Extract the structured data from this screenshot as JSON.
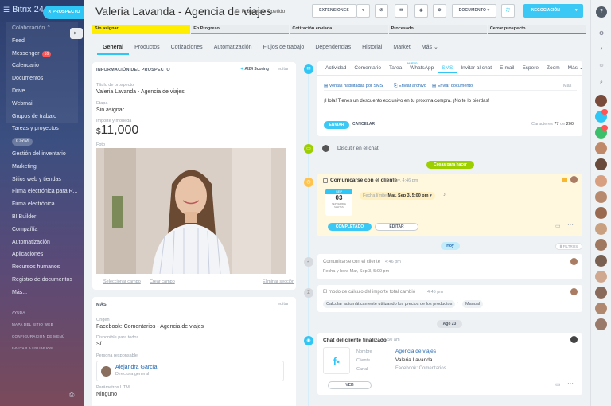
{
  "brand": "Bitrix 24",
  "sidebar": {
    "items": [
      {
        "label": "Colaboración",
        "kind": "group-head"
      },
      {
        "label": "Feed"
      },
      {
        "label": "Messenger",
        "badge": "16"
      },
      {
        "label": "Calendario"
      },
      {
        "label": "Documentos"
      },
      {
        "label": "Drive"
      },
      {
        "label": "Webmail"
      },
      {
        "label": "Grupos de trabajo"
      },
      {
        "label": "Tareas y proyectos"
      },
      {
        "label": "CRM",
        "kind": "crm"
      },
      {
        "label": "Gestión del inventario"
      },
      {
        "label": "Marketing"
      },
      {
        "label": "Sitios web y tiendas"
      },
      {
        "label": "Firma electrónica para R..."
      },
      {
        "label": "Firma electrónica"
      },
      {
        "label": "BI Builder"
      },
      {
        "label": "Compañía"
      },
      {
        "label": "Automatización"
      },
      {
        "label": "Aplicaciones"
      },
      {
        "label": "Recursos humanos"
      },
      {
        "label": "Registro de documentos"
      },
      {
        "label": "Más..."
      }
    ],
    "bottom": [
      "AYUDA",
      "MAPA DEL SITIO WEB",
      "CONFIGURACIÓN DE MENÚ",
      "INVITAR A USUARIOS"
    ]
  },
  "header": {
    "entity_tab": "PROSPECTO",
    "title": "Valeria Lavanda - Agencia de viajes",
    "repeat_label": "Prospecto repetido",
    "btn_extensions": "EXTENSIONES",
    "btn_document": "DOCUMENTO",
    "btn_negotiation": "NEGOCIACIÓN"
  },
  "stages": [
    {
      "label": "Sin asignar",
      "color": "#ffee00"
    },
    {
      "label": "En Progreso",
      "color": "#2fc6f6"
    },
    {
      "label": "Cotización enviada",
      "color": "#ffa900"
    },
    {
      "label": "Procesado",
      "color": "#7bd500"
    },
    {
      "label": "Cerrar prospecto",
      "color": "#00c4a0"
    }
  ],
  "tabs": [
    "General",
    "Productos",
    "Cotizaciones",
    "Automatización",
    "Flujos de trabajo",
    "Dependencias",
    "Historial",
    "Market",
    "Más"
  ],
  "info": {
    "heading": "INFORMACIÓN DEL PROSPECTO",
    "scoring": "AI24 Scoring",
    "edit": "editar",
    "title_label": "Título de prospecto",
    "title_value": "Valeria Lavanda - Agencia de viajes",
    "stage_label": "Etapa",
    "stage_value": "Sin asignar",
    "amount_label": "Importe y moneda",
    "amount_currency": "$",
    "amount_value": "11,000",
    "photo_label": "Foto",
    "select_field": "Seleccionar campo",
    "create_field": "Crear campo",
    "delete_section": "Eliminar sección"
  },
  "more": {
    "heading": "MÁS",
    "edit": "editar",
    "source_label": "Origen",
    "source_value": "Facebook: Comentarios - Agencia de viajes",
    "avail_label": "Disponible para todos",
    "avail_value": "Sí",
    "resp_label": "Persona responsable",
    "resp_name": "Alejandra García",
    "resp_role": "Directora general",
    "utm_label": "Parámetros UTM",
    "utm_value": "Ninguno"
  },
  "activity_tabs": [
    "Actividad",
    "Comentario",
    "Tarea",
    "WhatsApp",
    "SMS",
    "Invitar al chat",
    "E-mail",
    "Espere",
    "Zoom",
    "Más"
  ],
  "whatsapp_new": "NUEVO",
  "sms": {
    "enabled_link": "Ventas habilitadas por SMS",
    "send_file": "Enviar archivo",
    "send_doc": "Enviar documento",
    "more": "Más",
    "message": "¡Hola! Tienes un descuento exclusivo en tu próxima compra. ¡No te lo pierdas!",
    "send": "ENVIAR",
    "cancel": "CANCELAR",
    "chars_label": "Caracteres",
    "chars_used": "77",
    "chars_of": "de",
    "chars_max": "200"
  },
  "chat_prompt": "Discutir en el chat",
  "todo_pill": "Cosas para hacer",
  "task": {
    "title": "Comunicarse con el cliente",
    "time": "hoy, 4:46 pm",
    "deadline_label": "Fecha límite",
    "deadline_value": "Mar, Sep 3, 5:00 pm",
    "cal_month": "SEP",
    "cal_day": "03",
    "cal_sub": "SEPTIEMBRE",
    "cal_weekday": "MARTES",
    "done": "COMPLETADO",
    "edit": "EDITAR"
  },
  "today_pill": "Hoy",
  "filters": "FILTROS",
  "hist1": {
    "title": "Comunicarse con el cliente",
    "time": "4:46 pm",
    "detail": "Fecha y hora",
    "detail_value": "Mar, Sep 3, 5:00 pm"
  },
  "hist2": {
    "title": "El modo de cálculo del importe total cambió",
    "time": "4:45 pm",
    "from": "Calcular automáticamente utilizando los precios de los productos",
    "to": "Manual"
  },
  "date_pill": "Ago 23",
  "chat_done": {
    "title": "Chat del cliente finalizado",
    "time": "11:50 am",
    "name_label": "Nombre",
    "name_value": "Agencia de viajes",
    "client_label": "Cliente",
    "client_value": "Valeria Lavanda",
    "channel_label": "Canal",
    "channel_value": "Facebook: Comentarios",
    "view": "VER"
  }
}
